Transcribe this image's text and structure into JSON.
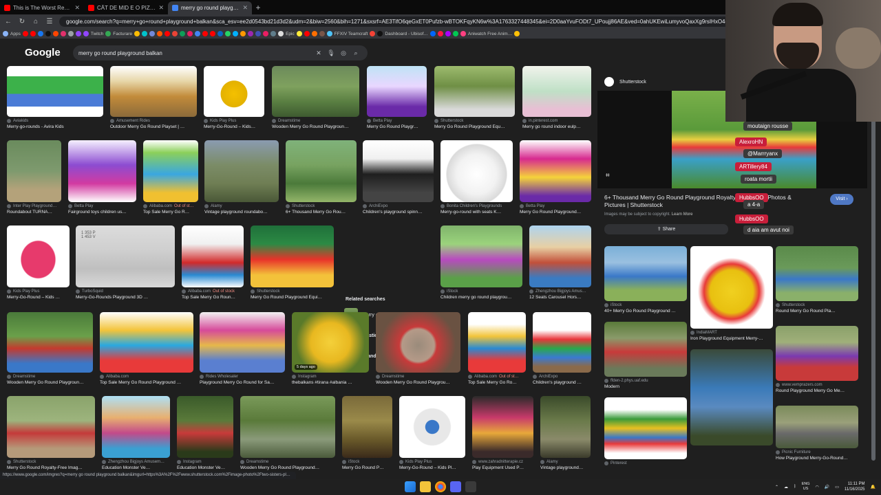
{
  "tabs": [
    {
      "title": "This is The Worst Reviewed Ho…",
      "icon": "youtube-icon",
      "color": "#ff0000"
    },
    {
      "title": "CÂT DE MID E O PIZZA FĂCUTĂ…",
      "icon": "youtube-icon",
      "color": "#ff0000"
    },
    {
      "title": "merry go round playground ba…",
      "icon": "google-icon",
      "color": "#4285f4"
    }
  ],
  "new_tab": "+",
  "address": {
    "url": "google.com/search?q=merry+go+round+playground+balkan&sca_esv=ee2d0543bd21d3d2&udm=2&biw=2560&bih=1271&sxsrf=AE3TifO6qeGxET0Pufzb-wBTOKFqyKN6w%3A1763327448345&ei=2D0aaYvuFODt7_UPoujj86AE&ved=0ahUKEwiLumyvoQaxXg9rsIHxO4dUDCBI&uact=5&oq=merry+go+round+playground+balkan&gs_lp=EgNpbWciIG1lcnJ5IGdvIHJvdW5kIHBsYXlncm91bmQ"
  },
  "bookmarks": [
    {
      "label": "Apps",
      "color": "#8ab4f8"
    },
    {
      "label": "",
      "color": "#ff0000"
    },
    {
      "label": "",
      "color": "#ff0000"
    },
    {
      "label": "",
      "color": "#1877f2"
    },
    {
      "label": "",
      "color": "#111111"
    },
    {
      "label": "",
      "color": "#ff4500"
    },
    {
      "label": "",
      "color": "#e1306c"
    },
    {
      "label": "",
      "color": "#9aa0a6"
    },
    {
      "label": "",
      "color": "#9146ff"
    },
    {
      "label": "Twitch",
      "color": "#9146ff"
    },
    {
      "label": "Facturare",
      "color": "#34a853"
    },
    {
      "label": "",
      "color": "#fbbc04"
    },
    {
      "label": "",
      "color": "#00c4cc"
    },
    {
      "label": "",
      "color": "#7289da"
    },
    {
      "label": "",
      "color": "#ff5700"
    },
    {
      "label": "",
      "color": "#ff0000"
    },
    {
      "label": "",
      "color": "#ea4335"
    },
    {
      "label": "",
      "color": "#0f9d58"
    },
    {
      "label": "",
      "color": "#e91e63"
    },
    {
      "label": "",
      "color": "#4285f4"
    },
    {
      "label": "",
      "color": "#ff0000"
    },
    {
      "label": "",
      "color": "#ff0000"
    },
    {
      "label": "",
      "color": "#0a66c2"
    },
    {
      "label": "",
      "color": "#25d366"
    },
    {
      "label": "",
      "color": "#00b0ff"
    },
    {
      "label": "",
      "color": "#ff9800"
    },
    {
      "label": "",
      "color": "#9c27b0"
    },
    {
      "label": "",
      "color": "#3f51b5"
    },
    {
      "label": "",
      "color": "#e91e63"
    },
    {
      "label": "",
      "color": "#607d8b"
    },
    {
      "label": "Epic",
      "color": "#dddddd"
    },
    {
      "label": "",
      "color": "#ffeb3b"
    },
    {
      "label": "",
      "color": "#ff0000"
    },
    {
      "label": "",
      "color": "#ff6f00"
    },
    {
      "label": "",
      "color": "#795548"
    },
    {
      "label": "FFXIV Teamcraft",
      "color": "#4fc3f7"
    },
    {
      "label": "",
      "color": "#f44336"
    },
    {
      "label": "Dashboard - Ubisof…",
      "color": "#111111"
    },
    {
      "label": "",
      "color": "#0066ff"
    },
    {
      "label": "",
      "color": "#ff1744"
    },
    {
      "label": "",
      "color": "#aa00ff"
    },
    {
      "label": "",
      "color": "#00c853"
    },
    {
      "label": "Aniwatch Free Anim…",
      "color": "#ff4081"
    },
    {
      "label": "",
      "color": "#ffc107"
    }
  ],
  "google": {
    "logo": "Google",
    "query": "merry go round playground balkan"
  },
  "grid": {
    "row1": [
      {
        "src": "Aviakids",
        "cap": "Merry-go-rounds - Avira Kids",
        "bg": "linear-gradient(180deg,#fff 0,#fff 20%,#3cb14a 20%,#3cb14a 55%,#4a7bd6 55%,#4a7bd6 80%,#fff 80%)"
      },
      {
        "src": "Amusement Rides",
        "cap": "Outdoor Merry Go Round Playset | …",
        "bg": "linear-gradient(180deg,#fff 0,#e7d6a8 30%,#c28b3a 60%,#8b6a3a)"
      },
      {
        "src": "Kids Play Plus",
        "cap": "Merry-Go-Round – Kids…",
        "bg": "radial-gradient(circle at 50% 55%,#f4c000 0,#e3b100 32%,#ffffff 33%)"
      },
      {
        "src": "Dreamstime",
        "cap": "Wooden Merry Go Round Playgroun…",
        "bg": "linear-gradient(180deg,#6c8a5b 0,#7fa15e 40%,#5a7f42 70%,#3e5a30)"
      },
      {
        "src": "Betta Play",
        "cap": "Merry Go Round Playgr…",
        "bg": "linear-gradient(180deg,#bfe3f5 0,#e9d7ff 40%,#6a2aa8 80%)"
      },
      {
        "src": "Shutterstock",
        "cap": "Merry Go Round Playground Equ…",
        "bg": "linear-gradient(180deg,#9dbb6e 0,#6f8f45 40%,#d9d9d9 85%)"
      },
      {
        "src": "in.pinterest.com",
        "cap": "Merry go round indoor eulp…",
        "bg": "linear-gradient(180deg,#f1f3ec 0,#bfe0c6 50%,#e8bfd4 85%)"
      }
    ],
    "row2": [
      {
        "src": "Inter Play Playground…",
        "cap": "Roundabout TURNA…",
        "bg": "linear-gradient(180deg,#6a8b5d 0,#7e9a6e 50%,#b4a27a 80%)"
      },
      {
        "src": "Betta Play",
        "cap": "Fairground toys children us…",
        "bg": "linear-gradient(180deg,#f5f0ff 0,#8c4cd1 40%,#d23aa1 70%,#fff)"
      },
      {
        "src": "Alibaba.com",
        "cap": "Top Sale Merry Go R…",
        "badge": "Out of st…",
        "bg": "linear-gradient(180deg,#fff 0,#8bd05a 20%,#3aa7e0 55%,#f0c030 85%)"
      },
      {
        "src": "Alamy",
        "cap": "Vintage playground roundabo…",
        "bg": "linear-gradient(180deg,#8a9bb0 0,#7b8c67 40%,#6f7e54 70%,#4a5837)"
      },
      {
        "src": "Shutterstock",
        "cap": "6+ Thousand Merry Go Rou…",
        "bg": "linear-gradient(180deg,#7fb27a 0,#78a361 40%,#4b7a3a 70%,#93b569)"
      },
      {
        "src": "ArchiExpo",
        "cap": "Children's playground spinn…",
        "bg": "linear-gradient(180deg,#fff 0,#f0f0f0 30%,#1e1e1e 55%,#444 85%)"
      },
      {
        "src": "Bonita Children's Playgrounds",
        "cap": "Merry-go-round with seats K…",
        "bg": "radial-gradient(circle at 50% 55%,#ffffff 0,#f2f2f2 40%,#dadada 60%,#ffffff 62%)"
      },
      {
        "src": "Betta Play",
        "cap": "Merry Go Round Playground…",
        "bg": "linear-gradient(180deg,#fff 0,#d72a8f 30%,#f5d33a 60%,#6a2aa8 90%)"
      }
    ],
    "row3": [
      {
        "src": "Kids Play Plus",
        "cap": "Merry-Go-Round – Kids …",
        "bg": "radial-gradient(ellipse at 50% 55%,#e73a6c 0,#e73a6c 38%,#ffffff 40%)"
      },
      {
        "src": "TurboSquid",
        "cap": "Merry-Go-Rounds Playground 3D …",
        "note": "1 353 P\n1 453 V",
        "bg": "linear-gradient(180deg,#dcdcdc 0,#cfcfcf 40%,#bfbfbf 70%,#d8d8d8)"
      },
      {
        "src": "Alibaba.com",
        "cap": "Top Sale Merry Go Roun…",
        "badge": "Out of stock",
        "bg": "linear-gradient(180deg,#fff 0,#f0f0f0 30%,#d22a2a 60%,#2a8ad2 80%,#fff)"
      },
      {
        "src": "Shutterstock",
        "cap": "Merry Go Round Playground Equi…",
        "bg": "linear-gradient(180deg,#1f6f3a 0,#2c8a44 30%,#e8332a 55%,#f3c23a 80%)"
      },
      {
        "src": "iStock",
        "cap": "Children merry go round playgrou…",
        "bg": "linear-gradient(180deg,#7fb36b 0,#9bd37c 30%,#b84ac0 55%,#5aa048 85%)"
      },
      {
        "src": "Zhengzhou Bigjoys Amus…",
        "cap": "12 Seats Carousel Hors…",
        "bg": "linear-gradient(180deg,#aed4ef 0,#e8d0a4 35%,#c2503a 60%,#3a7bc2 85%)"
      }
    ],
    "row4": [
      {
        "src": "Dreamstime",
        "cap": "Wooden Merry Go Round Playgroun…",
        "bg": "linear-gradient(180deg,#4a7a3a 0,#6aa04a 40%,#c43a2e 60%,#3a78c8 85%)"
      },
      {
        "src": "Alibaba.com",
        "cap": "Top Sale Merry Go Round Playground …",
        "bg": "linear-gradient(180deg,#fff 0,#f3c43a 30%,#2aa8e0 55%,#e83a3a 80%)"
      },
      {
        "src": "Rides Wholesaler",
        "cap": "Playground Merry Go Round for Sa…",
        "bg": "linear-gradient(180deg,#f2f2f2 0,#d64a9a 30%,#e6b84a 55%,#5a7fd0 80%)"
      },
      {
        "src": "Instagram",
        "cap": "thebalkans #tirana #albania …",
        "badge": "5 days ago",
        "bg": "radial-gradient(circle at 50% 50%,#f4d03a 0,#e8b820 40%,#5a7a2a 70%)"
      },
      {
        "src": "Dreamstime",
        "cap": "Wooden Merry Go Round Playgrou…",
        "bg": "radial-gradient(circle at 50% 55%,#9a8b7b 0,#b59a88 30%,#c83a3a 35%,#6a5242 70%)"
      },
      {
        "src": "Alibaba.com",
        "cap": "Top Sale Merry Go Ro…",
        "badge": "Out of st…",
        "bg": "linear-gradient(180deg,#fff 0,#fff 20%,#f2c43a 40%,#2a8ad2 60%,#e83a3a 80%)"
      },
      {
        "src": "ArchiExpo",
        "cap": "Children's playground …",
        "bg": "linear-gradient(180deg,#fff 0,#fff 30%,#e8343a 45%,#2aa84a 60%,#3a7ad2 75%,#8a6a4a 90%)"
      }
    ],
    "row5": [
      {
        "src": "Shutterstock",
        "cap": "Merry Go Round Royalty-Free Imag…",
        "bg": "linear-gradient(180deg,#8aa36b 0,#9db47d 40%,#c43a3a 60%,#b59a7a 85%)"
      },
      {
        "src": "Zhengzhou Bigjoys Amusem…",
        "cap": "Education Monster Ve…",
        "bg": "linear-gradient(180deg,#aee0f5 0,#e8b070 35%,#c24a8a 60%,#3aa0d2 85%)"
      },
      {
        "src": "Instagram",
        "cap": "Education Monster Ve…",
        "bg": "linear-gradient(180deg,#3a5a2a 0,#5a7a3a 40%,#c83a3a 60%,#2a3a1a 90%)"
      },
      {
        "src": "Dreamstime",
        "cap": "Wooden Merry Go Round Playground…",
        "bg": "linear-gradient(180deg,#7a9a5a 0,#5a7a3a 40%,#8a9a7a 70%,#4a5a3a)"
      },
      {
        "src": "iStock",
        "cap": "Merry Go Round P…",
        "bg": "linear-gradient(180deg,#7a6a3a 0,#9a8a4a 40%,#6a5a2a 70%,#3a2a1a)"
      },
      {
        "src": "Kids Play Plus",
        "cap": "Merry-Go-Round – Kids Pl…",
        "bg": "radial-gradient(circle at 50% 50%,#3a78c8 0,#3a78c8 15%,#e8e8e8 16%,#e8e8e8 40%,#ffffff 42%)"
      },
      {
        "src": "www.zahradnitterapie.cz",
        "cap": "Play Equipment Used P…",
        "bg": "linear-gradient(180deg,#2a2a2a 0,#c83a6a 35%,#e8a83a 60%,#3a2a2a 90%)"
      },
      {
        "src": "Alamy",
        "cap": "Vintage playground…",
        "bg": "linear-gradient(180deg,#3a4a2a 0,#6a7a4a 40%,#8a8a6a 70%,#3a3a2a)"
      }
    ]
  },
  "related": {
    "title": "Related searches",
    "items": [
      {
        "text": "merry go round playground",
        "bold": "",
        "bg": "linear-gradient(180deg,#7fa15e,#3a5a2a)"
      },
      {
        "text": " merry go round",
        "bold": "plastic",
        "bg": "linear-gradient(180deg,#fff,#d63a8a,#3a78c8)"
      },
      {
        "text": " playground",
        "bold": "abandoned",
        "bg": "linear-gradient(180deg,#8a8a6a,#4a5a3a)"
      }
    ]
  },
  "panel": {
    "source": "Shutterstock",
    "title": "6+ Thousand Merry Go Round Playground Royalty-Free Stock Photos & Pictures | Shutterstock",
    "visit": "Visit",
    "copyright_prefix": "Images may be subject to copyright.",
    "learn_more": "Learn More",
    "share": "Share",
    "image_bg": "linear-gradient(180deg,#7ab04a 0,#5a9a3a 40%,#e8d040 50%,#e83a3a 58%,#3aa0c8 70%,#4a8a2a 100%)",
    "watermark": "shutterstock.com",
    "related": [
      {
        "src": "iStock",
        "cap": "40+ Merry Go Round Playground …",
        "bg": "linear-gradient(180deg,#7ab0d8 0,#9ac0e0 30%,#3a78c8 55%,#8ab05a 80%)"
      },
      {
        "src": "IndiaMART",
        "cap": "Iron Playground Equipment Merry-…",
        "bg": "radial-gradient(circle at 50% 55%,#f0d020 0,#e8c010 35%,#e83a3a 45%,#ffffff 55%)"
      },
      {
        "src": "Shutterstock",
        "cap": "Round Merry Go Round Pla…",
        "bg": "linear-gradient(180deg,#5a8a4a 0,#6a9a5a 40%,#3a78c8 60%,#8ab06a 85%)"
      },
      {
        "src": "ffden-2.phys.uaf.edu",
        "cap": "Modern",
        "bg": "linear-gradient(180deg,#5a7a3a 0,#8a9a6a 30%,#c83a3a 55%,#6a7a5a 85%)"
      },
      {
        "src": "",
        "cap": "",
        "bg": "linear-gradient(180deg,#3a4a3a 0,#3a7ab8 40%,#5a8ac0 60%,#3a4a2a 90%)"
      },
      {
        "src": "www.vemprazers.com",
        "cap": "Round Playground Merry Go Me…",
        "bg": "linear-gradient(180deg,#8aa06a 0,#a0b07a 30%,#7a3ab0 55%,#c83a3a 75%)"
      },
      {
        "src": "Pinterest",
        "cap": "",
        "bg": "linear-gradient(180deg,#fff 0,#fff 20%,#3a9a3a 35%,#e8c020 50%,#3a78c8 65%,#e83a3a 75%,#fff 90%)"
      },
      {
        "src": "Picnic Furniture",
        "cap": "How Playground Merry-Go-Round…",
        "bg": "linear-gradient(180deg,#7a8a5a 0,#9aa07a 40%,#6a6a6a 65%,#4a5a3a)"
      }
    ]
  },
  "chat": [
    {
      "text": "moutaign rousse",
      "bg": "#3a3a3a"
    },
    {
      "text": "AlexroHN",
      "bg": "#c81e3a"
    },
    {
      "text": "@Marrryanx",
      "bg": "#3a3a3a"
    },
    {
      "text": "ARTillery84",
      "bg": "#c81e3a"
    },
    {
      "text": "roata mortii",
      "bg": "#3a3a3a"
    },
    {
      "text": "HubbsOO",
      "bg": "#c81e3a"
    },
    {
      "text": "a 4-a",
      "bg": "#3a3a3a"
    },
    {
      "text": "HubbsOO",
      "bg": "#c81e3a"
    },
    {
      "text": "d aia am avut noi",
      "bg": "#3a3a3a"
    }
  ],
  "status_url": "https://www.google.com/imgres?q=merry go round playground balkan&imgurl=https%3A%2F%2Fwww.shutterstock.com%2Fimage-photo%2Ftwo-sisters-pl…",
  "taskbar": {
    "lang_top": "ENG",
    "lang_bottom": "US",
    "time": "11:11 PM",
    "date": "11/16/2025"
  }
}
